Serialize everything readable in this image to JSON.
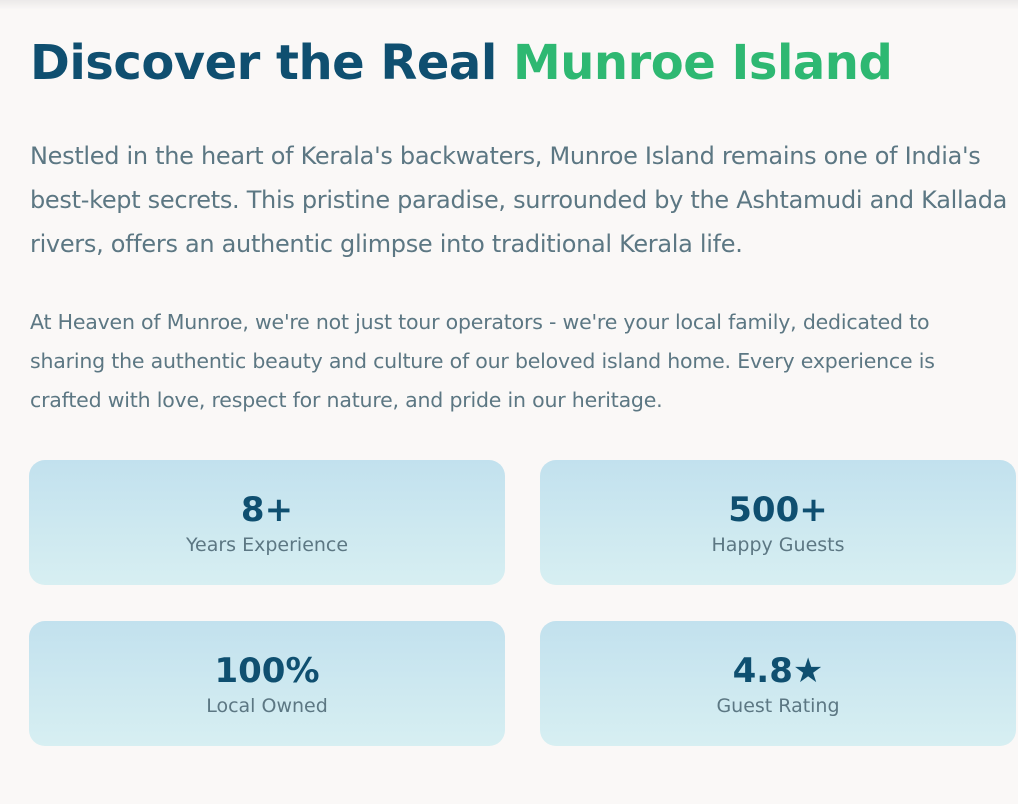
{
  "hero": {
    "title_main": "Discover the Real ",
    "title_accent": "Munroe Island",
    "lead": "Nestled in the heart of Kerala's backwaters, Munroe Island remains one of India's best-kept secrets. This pristine paradise, surrounded by the Ashtamudi and Kallada rivers, offers an authentic glimpse into traditional Kerala life.",
    "body": "At Heaven of Munroe, we're not just tour operators - we're your local family, dedicated to sharing the authentic beauty and culture of our beloved island home. Every experience is crafted with love, respect for nature, and pride in our heritage."
  },
  "stats": [
    {
      "value": "8+",
      "label": "Years Experience"
    },
    {
      "value": "500+",
      "label": "Happy Guests"
    },
    {
      "value": "100%",
      "label": "Local Owned"
    },
    {
      "value": "4.8★",
      "label": "Guest Rating"
    }
  ],
  "colors": {
    "heading": "#0f4f70",
    "accent": "#2eb872",
    "text": "#5c7783",
    "card": "#c9e6f0",
    "background": "#faf8f7"
  }
}
